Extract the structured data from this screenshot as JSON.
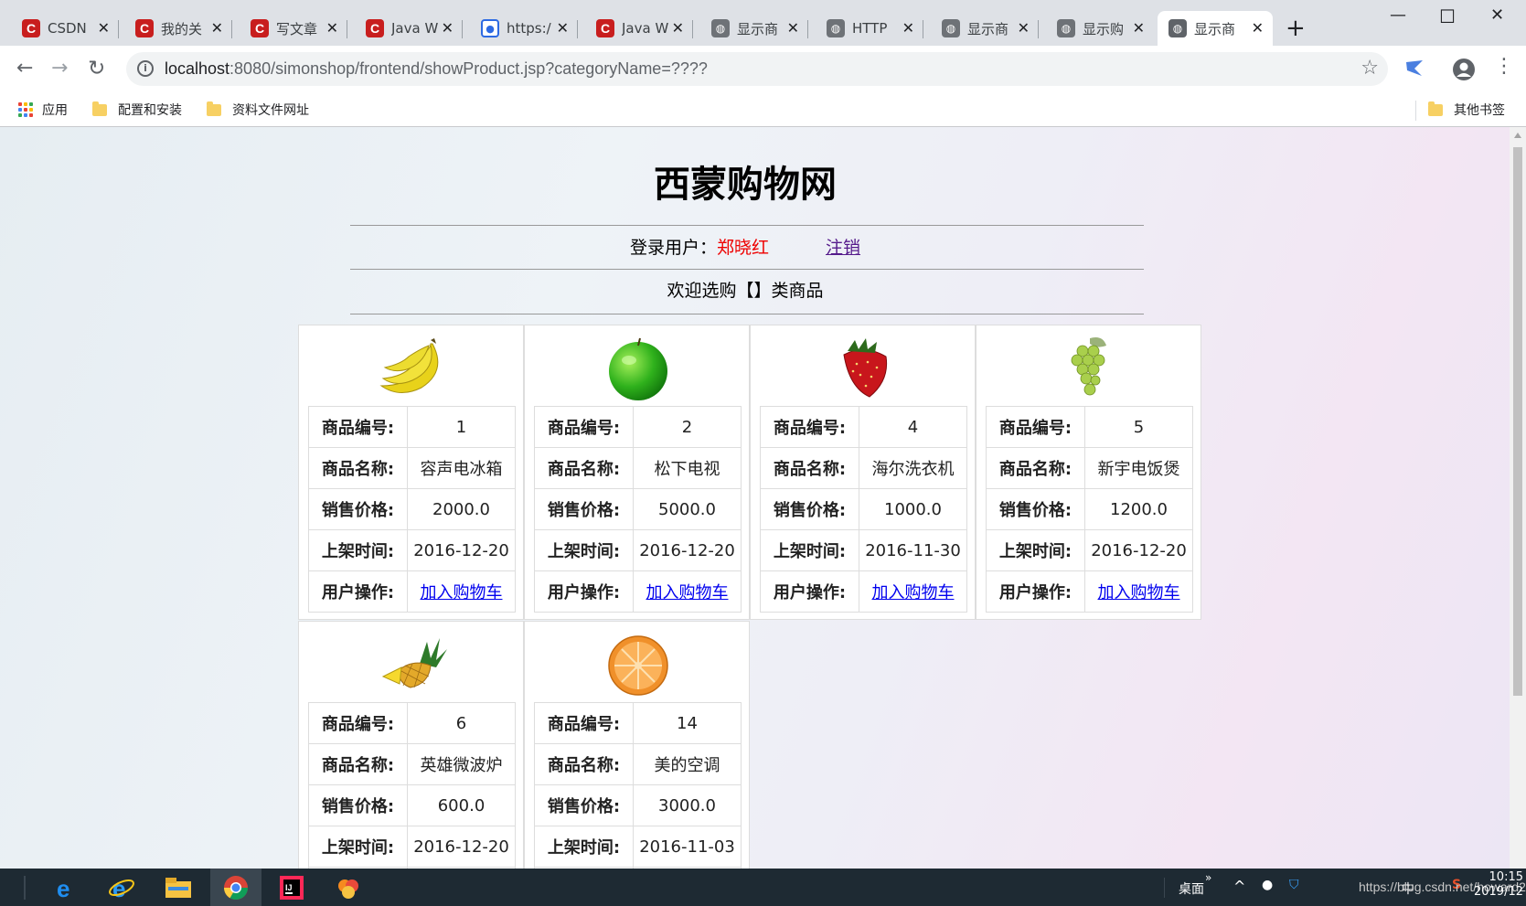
{
  "browser": {
    "tabs": [
      {
        "title": "CSDN",
        "icon": "csdn-icon"
      },
      {
        "title": "我的关",
        "icon": "csdn-icon"
      },
      {
        "title": "写文章",
        "icon": "csdn-icon"
      },
      {
        "title": "Java W",
        "icon": "csdn-icon"
      },
      {
        "title": "https:/",
        "icon": "baidu-icon"
      },
      {
        "title": "Java W",
        "icon": "csdn-icon"
      },
      {
        "title": "显示商",
        "icon": "globe-icon"
      },
      {
        "title": "HTTP",
        "icon": "globe-icon"
      },
      {
        "title": "显示商",
        "icon": "globe-icon"
      },
      {
        "title": "显示购",
        "icon": "globe-icon"
      },
      {
        "title": "显示商",
        "icon": "globe-icon",
        "active": true
      }
    ],
    "address": {
      "host": "localhost",
      "rest": ":8080/simonshop/frontend/showProduct.jsp?categoryName=????"
    },
    "bookmarks": {
      "apps": "应用",
      "folder1": "配置和安装",
      "folder2": "资料文件网址",
      "other": "其他书签"
    }
  },
  "page": {
    "title": "西蒙购物网",
    "login_label": "登录用户：",
    "username": "郑晓红",
    "logout": "注销",
    "welcome": "欢迎选购【】类商品"
  },
  "labels": {
    "id": "商品编号:",
    "name": "商品名称:",
    "price": "销售价格:",
    "date": "上架时间:",
    "action": "用户操作:",
    "add_to_cart": "加入购物车"
  },
  "products": [
    {
      "id": "1",
      "name": "容声电冰箱",
      "price": "2000.0",
      "date": "2016-12-20",
      "image": "banana-icon"
    },
    {
      "id": "2",
      "name": "松下电视",
      "price": "5000.0",
      "date": "2016-12-20",
      "image": "apple-icon"
    },
    {
      "id": "4",
      "name": "海尔洗衣机",
      "price": "1000.0",
      "date": "2016-11-30",
      "image": "strawberry-icon"
    },
    {
      "id": "5",
      "name": "新宇电饭煲",
      "price": "1200.0",
      "date": "2016-12-20",
      "image": "grapes-icon"
    },
    {
      "id": "6",
      "name": "英雄微波炉",
      "price": "600.0",
      "date": "2016-12-20",
      "image": "pineapple-icon"
    },
    {
      "id": "14",
      "name": "美的空调",
      "price": "3000.0",
      "date": "2016-11-03",
      "image": "orange-icon"
    }
  ],
  "taskbar": {
    "desktop": "桌面",
    "ime": "中",
    "watermark": "https://blog.csdn.net/howard2005",
    "time": "10:15",
    "date": "2019/12"
  },
  "colors": {
    "username": "#ee0000",
    "link": "#0000ee",
    "visited_link": "#551a8b",
    "csdn_red": "#c81e1e"
  }
}
